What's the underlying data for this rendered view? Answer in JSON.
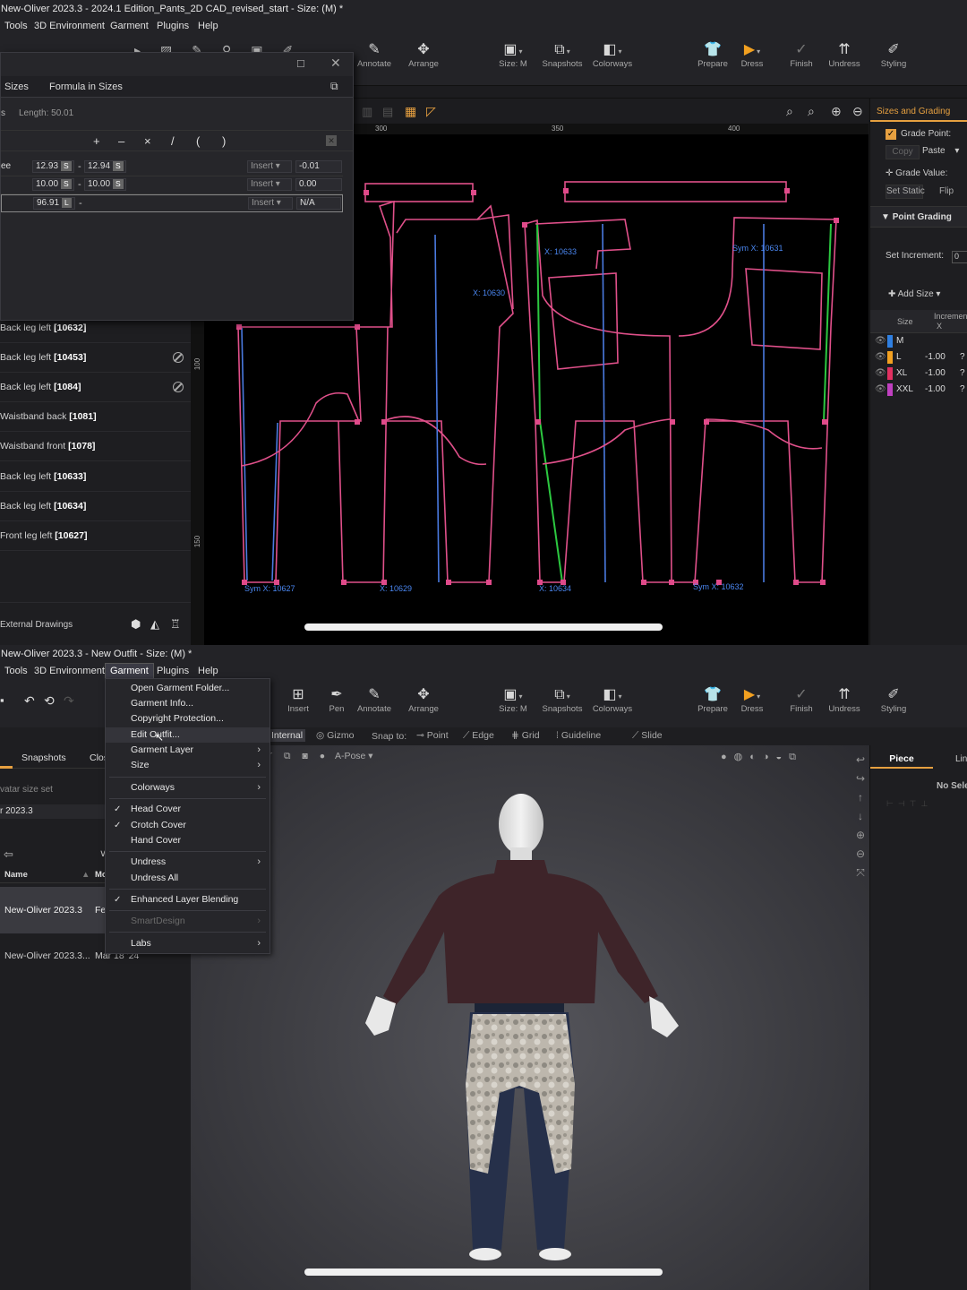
{
  "top": {
    "title": "New-Oliver 2023.3 - 2024.1 Edition_Pants_2D CAD_revised_start - Size: (M) *",
    "menu": [
      "Tools",
      "3D Environment",
      "Garment",
      "Plugins",
      "Help"
    ],
    "toolbar": [
      {
        "label": "Annotate",
        "icon": "annotate-icon"
      },
      {
        "label": "Arrange",
        "icon": "arrange-icon"
      },
      {
        "label": "Size: M",
        "icon": "size-icon"
      },
      {
        "label": "Snapshots",
        "icon": "snapshots-icon"
      },
      {
        "label": "Colorways",
        "icon": "colorways-icon"
      },
      {
        "label": "Prepare",
        "icon": "prepare-icon"
      },
      {
        "label": "Dress",
        "icon": "dress-play-icon"
      },
      {
        "label": "Finish",
        "icon": "finish-icon"
      },
      {
        "label": "Undress",
        "icon": "undress-icon"
      },
      {
        "label": "Styling",
        "icon": "styling-icon"
      }
    ],
    "formula": {
      "tabs": [
        "Sizes",
        "Formula in Sizes"
      ],
      "s_label": "s",
      "length": "Length: 50.01",
      "ops": [
        "+",
        "–",
        "×",
        "/",
        "(",
        ")"
      ],
      "rows": [
        {
          "name": "ee",
          "a": "12.93",
          "ab": "S",
          "b": "12.94",
          "bb": "S",
          "mode": "Insert",
          "result": "-0.01"
        },
        {
          "name": "",
          "a": "10.00",
          "ab": "S",
          "b": "10.00",
          "bb": "S",
          "mode": "Insert",
          "result": "0.00"
        },
        {
          "name": "",
          "a": "96.91",
          "ab": "L",
          "b": "",
          "bb": "",
          "mode": "Insert",
          "result": "N/A"
        }
      ]
    },
    "pieces": [
      {
        "name": "Back leg left",
        "id": "[10632]",
        "ban": false
      },
      {
        "name": "Back leg left",
        "id": "[10453]",
        "ban": true
      },
      {
        "name": "Back leg left",
        "id": "[1084]",
        "ban": true
      },
      {
        "name": "Waistband back",
        "id": "[1081]",
        "ban": false
      },
      {
        "name": "Waistband front",
        "id": "[1078]",
        "ban": false
      },
      {
        "name": "Back leg left",
        "id": "[10633]",
        "ban": false
      },
      {
        "name": "Back leg left",
        "id": "[10634]",
        "ban": false
      },
      {
        "name": "Front leg left",
        "id": "[10627]",
        "ban": false
      }
    ],
    "external": "External Drawings",
    "ruler": [
      "300",
      "350",
      "400"
    ],
    "vruler": [
      "100",
      "150"
    ],
    "labels": [
      "Sym X: 10627",
      "X: 10629",
      "X: 10634",
      "Sym X: 10632",
      "X: 10630",
      "X: 10633",
      "Sym X: 10631"
    ],
    "grading": {
      "title": "Sizes and Grading",
      "grade_point": "Grade Point:",
      "copy": "Copy",
      "paste": "Paste",
      "grade_value": "Grade Value:",
      "set_static": "Set Static",
      "flip": "Flip",
      "point_grading": "Point Grading",
      "set_increment": "Set Increment:",
      "increment_val": "0",
      "add_size": "Add Size",
      "col_size": "Size",
      "col_inc": "Incremen",
      "col_x": "X",
      "sizes": [
        {
          "size": "M",
          "x": "",
          "q": "",
          "color": "#2f7fe0"
        },
        {
          "size": "L",
          "x": "-1.00",
          "q": "?",
          "color": "#f2a020"
        },
        {
          "size": "XL",
          "x": "-1.00",
          "q": "?",
          "color": "#e03060"
        },
        {
          "size": "XXL",
          "x": "-1.00",
          "q": "?",
          "color": "#c040c0"
        }
      ]
    }
  },
  "bottom": {
    "title": "New-Oliver 2023.3 - New Outfit - Size: (M) *",
    "menu": [
      "Tools",
      "3D Environment",
      "Garment",
      "Plugins",
      "Help"
    ],
    "toolbar": [
      {
        "label": "Insert",
        "icon": "insert-icon"
      },
      {
        "label": "Pen",
        "icon": "pen-icon"
      },
      {
        "label": "Annotate",
        "icon": "annotate-icon"
      },
      {
        "label": "Arrange",
        "icon": "arrange-icon"
      },
      {
        "label": "Size: M",
        "icon": "size-icon"
      },
      {
        "label": "Snapshots",
        "icon": "snapshots-icon"
      },
      {
        "label": "Colorways",
        "icon": "colorways-icon"
      },
      {
        "label": "Prepare",
        "icon": "prepare-icon"
      },
      {
        "label": "Dress",
        "icon": "dress-play-icon"
      },
      {
        "label": "Finish",
        "icon": "finish-icon"
      },
      {
        "label": "Undress",
        "icon": "undress-icon"
      },
      {
        "label": "Styling",
        "icon": "styling-icon"
      }
    ],
    "snapbar": {
      "internal": "Internal",
      "gizmo": "Gizmo",
      "snap_to": "Snap to:",
      "point": "Point",
      "edge": "Edge",
      "grid": "Grid",
      "guideline": "Guideline",
      "slide": "Slide"
    },
    "apose": "A-Pose",
    "left": {
      "tabs": [
        "Snapshots",
        "Clos"
      ],
      "avatar_size_set": "vatar size set",
      "version": "r 2023.3",
      "col_name": "Name",
      "col_mod": "Mo",
      "rows": [
        {
          "name": "New-Oliver 2023.3",
          "mod": "Fe"
        },
        {
          "name": "New-Oliver 2023.3...",
          "mod": "Mar 18 '24"
        }
      ]
    },
    "right": {
      "tab": "Piece",
      "tab2": "Lin",
      "no_sel": "No Sele"
    },
    "garment_menu": [
      {
        "label": "Open Garment Folder...",
        "check": false,
        "sub": false,
        "dis": false
      },
      {
        "label": "Garment Info...",
        "check": false,
        "sub": false,
        "dis": false
      },
      {
        "label": "Copyright Protection...",
        "check": false,
        "sub": false,
        "dis": false
      },
      {
        "label": "Edit Outfit...",
        "check": false,
        "sub": false,
        "dis": false
      },
      {
        "label": "Garment Layer",
        "check": false,
        "sub": true,
        "dis": false
      },
      {
        "label": "Size",
        "check": false,
        "sub": true,
        "dis": false
      },
      {
        "label": "Colorways",
        "check": false,
        "sub": true,
        "dis": false
      },
      {
        "label": "Head Cover",
        "check": true,
        "sub": false,
        "dis": false
      },
      {
        "label": "Crotch Cover",
        "check": true,
        "sub": false,
        "dis": false
      },
      {
        "label": "Hand Cover",
        "check": false,
        "sub": false,
        "dis": false
      },
      {
        "label": "Undress",
        "check": false,
        "sub": true,
        "dis": false
      },
      {
        "label": "Undress All",
        "check": false,
        "sub": false,
        "dis": false
      },
      {
        "label": "Enhanced Layer Blending",
        "check": true,
        "sub": false,
        "dis": false
      },
      {
        "label": "SmartDesign",
        "check": false,
        "sub": true,
        "dis": true
      },
      {
        "label": "Labs",
        "check": false,
        "sub": true,
        "dis": false
      }
    ]
  }
}
